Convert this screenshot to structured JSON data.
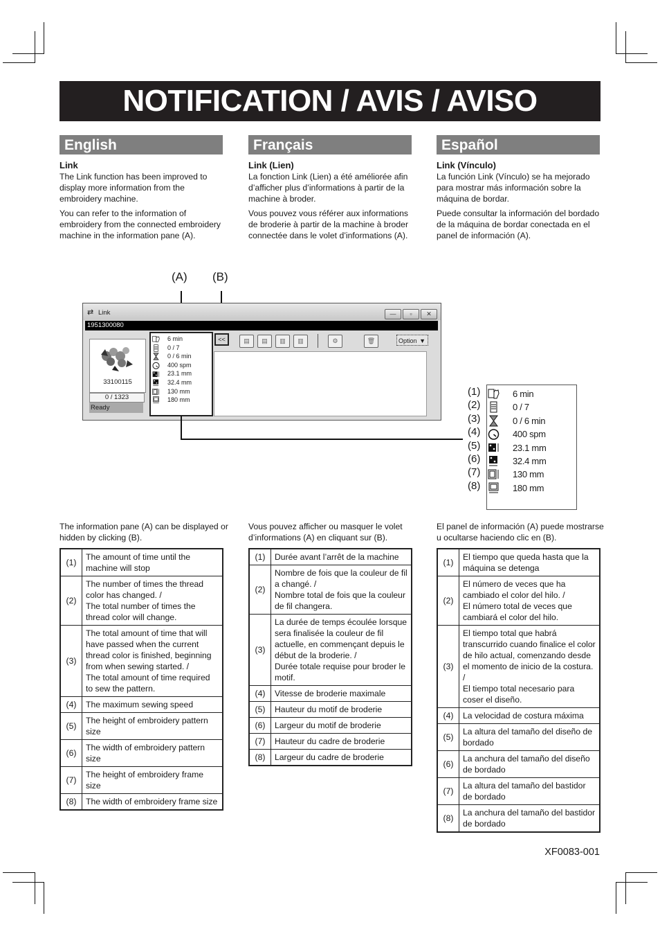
{
  "banner": {
    "title": "NOTIFICATION / AVIS / AVISO"
  },
  "columns": [
    {
      "lang": "English",
      "heading": "Link",
      "paragraphs": [
        "The Link function has been improved to display more information from the embroidery machine.",
        "You can refer to the information of embroidery from the connected embroidery machine in the information pane (A)."
      ],
      "intro": "The information pane (A) can be displayed or hidden by clicking (B).",
      "rows": [
        {
          "n": "(1)",
          "text": "The amount of time until the machine will stop"
        },
        {
          "n": "(2)",
          "text": "The number of times the thread color has changed. / The total number of times the thread color will change."
        },
        {
          "n": "(3)",
          "text": "The total amount of time that will have passed when the current thread color is finished, beginning from when sewing started. / The total amount of time required to sew the pattern."
        },
        {
          "n": "(4)",
          "text": "The maximum sewing speed"
        },
        {
          "n": "(5)",
          "text": "The height of embroidery pattern size"
        },
        {
          "n": "(6)",
          "text": "The width of embroidery pattern size"
        },
        {
          "n": "(7)",
          "text": "The height of embroidery frame size"
        },
        {
          "n": "(8)",
          "text": "The width of embroidery frame size"
        }
      ]
    },
    {
      "lang": "Français",
      "heading": "Link (Lien)",
      "paragraphs": [
        "La fonction Link (Lien) a été améliorée afin d’afficher plus d’informations à partir de la machine à broder.",
        "Vous pouvez vous référer aux informations de broderie à partir de la machine à broder connectée dans le volet d’informations (A)."
      ],
      "intro": "Vous pouvez afficher ou masquer le volet d’informations (A) en cliquant sur (B).",
      "rows": [
        {
          "n": "(1)",
          "text": "Durée avant l’arrêt de la machine"
        },
        {
          "n": "(2)",
          "text": "Nombre de fois que la couleur de fil a changé. / Nombre total de fois que la couleur de fil changera."
        },
        {
          "n": "(3)",
          "text": "La durée de temps écoulée lorsque sera finalisée la couleur de fil actuelle, en commençant depuis le début de la broderie. / Durée totale requise pour broder le motif."
        },
        {
          "n": "(4)",
          "text": "Vitesse de broderie maximale"
        },
        {
          "n": "(5)",
          "text": "Hauteur du motif de broderie"
        },
        {
          "n": "(6)",
          "text": "Largeur du motif de broderie"
        },
        {
          "n": "(7)",
          "text": "Hauteur du cadre de broderie"
        },
        {
          "n": "(8)",
          "text": "Largeur du cadre de broderie"
        }
      ]
    },
    {
      "lang": "Español",
      "heading": "Link (Vínculo)",
      "paragraphs": [
        "La función Link (Vínculo) se ha mejorado para mostrar más información sobre la máquina de bordar.",
        "Puede consultar la información del bordado de la máquina de bordar conectada en el panel de información (A)."
      ],
      "intro": "El panel de información (A) puede mostrarse u ocultarse haciendo clic en (B).",
      "rows": [
        {
          "n": "(1)",
          "text": "El tiempo que queda hasta que la máquina se detenga"
        },
        {
          "n": "(2)",
          "text": "El número de veces que ha cambiado el color del hilo. / El número total de veces que cambiará el color del hilo."
        },
        {
          "n": "(3)",
          "text": "El tiempo total que habrá transcurrido cuando finalice el color de hilo actual, comenzando desde el momento de inicio de la costura. / El tiempo total necesario para coser el diseño."
        },
        {
          "n": "(4)",
          "text": "La velocidad de costura máxima"
        },
        {
          "n": "(5)",
          "text": "La altura del tamaño del diseño de bordado"
        },
        {
          "n": "(6)",
          "text": "La anchura del tamaño del diseño de bordado"
        },
        {
          "n": "(7)",
          "text": "La altura del tamaño del bastidor de bordado"
        },
        {
          "n": "(8)",
          "text": "La anchura del tamaño del bastidor de bordado"
        }
      ]
    }
  ],
  "callouts": {
    "a": "(A)",
    "b": "(B)"
  },
  "window": {
    "title": "Link",
    "serial": "1951300080",
    "design_id": "33100115",
    "stitch_counter": "0 / 1323",
    "status": "Ready",
    "toggle_label": "<<",
    "option_label": "Option",
    "controls": {
      "minimize": "—",
      "maximize": "▫",
      "close": "✕"
    }
  },
  "info_pane": [
    {
      "n": "(1)",
      "icon": "hand-timer-icon",
      "value": "6 min"
    },
    {
      "n": "(2)",
      "icon": "thread-spool-icon",
      "value": "0 / 7"
    },
    {
      "n": "(3)",
      "icon": "hourglass-icon",
      "value": "0 / 6 min"
    },
    {
      "n": "(4)",
      "icon": "speedometer-icon",
      "value": "400 spm"
    },
    {
      "n": "(5)",
      "icon": "pattern-height-icon",
      "value": "23.1 mm"
    },
    {
      "n": "(6)",
      "icon": "pattern-width-icon",
      "value": "32.4 mm"
    },
    {
      "n": "(7)",
      "icon": "frame-height-icon",
      "value": "130 mm"
    },
    {
      "n": "(8)",
      "icon": "frame-width-icon",
      "value": "180 mm"
    }
  ],
  "footer": {
    "doc_id": "XF0083-001"
  }
}
